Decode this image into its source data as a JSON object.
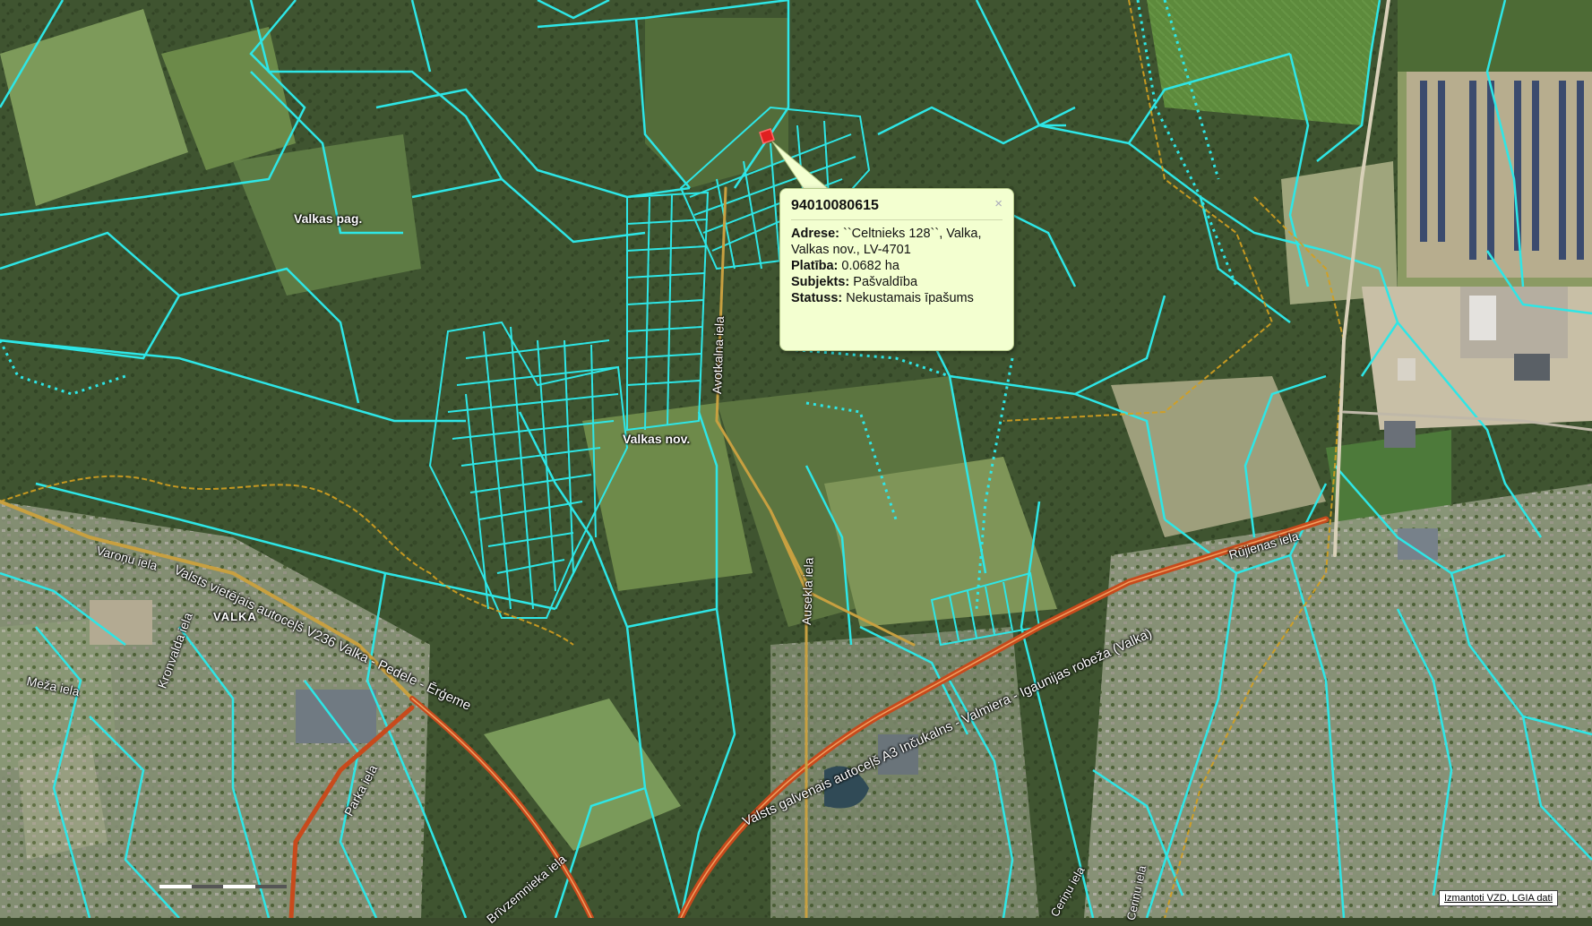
{
  "map": {
    "labels": {
      "valkas_pag": "Valkas pag.",
      "valkas_nov": "Valkas nov.",
      "valka": "VALKA"
    },
    "streets": {
      "avotkalna": "Avotkalna iela",
      "auseklа": "Auseklа iela",
      "varonu": "Varoņu iela",
      "v236": "Valsts vietējais autoceļš V236 Valka - Pedele - Ērģeme",
      "a3": "Valsts galvenais autoceļš A3 Inčukalns - Valmiera - Igaunijas robeža (Valka)",
      "rujienas": "Rūjienas iela",
      "kronvalda": "Kronvalda iela",
      "meza": "Meža iela",
      "parka": "Parka iela",
      "brivzemnieka": "Brīvzemnieka iela",
      "cerinu1": "Ceriņu iela",
      "cerinu2": "Ceriņu iela"
    },
    "colors": {
      "parcel_outline": "#2ee6e6",
      "road_main": "#c84a1c",
      "admin_border": "#d4a020"
    }
  },
  "popup": {
    "title": "94010080615",
    "close_symbol": "×",
    "adrese_label": "Adrese:",
    "adrese_value": " ``Celtnieks 128``, Valka, Valkas nov., LV-4701",
    "platiba_label": "Platība:",
    "platiba_value": " 0.0682 ha",
    "subjekts_label": "Subjekts:",
    "subjekts_value": " Pašvaldība",
    "statuss_label": "Statuss:",
    "statuss_value": " Nekustamais īpašums"
  },
  "attribution": "Izmantoti VZD, LGIA dati"
}
